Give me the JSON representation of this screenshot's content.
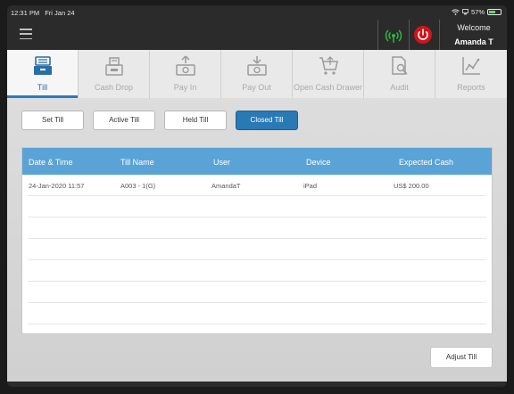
{
  "status_bar": {
    "time": "12:31 PM",
    "date": "Fri Jan 24",
    "battery": "57%",
    "battery_level": 0.57
  },
  "header": {
    "welcome": "Welcome",
    "user": "Amanda T"
  },
  "tabs": [
    {
      "label": "Till",
      "icon": "till-drawer-icon",
      "active": true
    },
    {
      "label": "Cash Drop",
      "icon": "cash-drop-icon"
    },
    {
      "label": "Pay In",
      "icon": "pay-in-icon"
    },
    {
      "label": "Pay Out",
      "icon": "pay-out-icon"
    },
    {
      "label": "Open Cash Drawer",
      "icon": "cart-icon"
    },
    {
      "label": "Audit",
      "icon": "audit-search-icon"
    },
    {
      "label": "Reports",
      "icon": "line-chart-icon"
    }
  ],
  "filters": [
    {
      "label": "Set Till"
    },
    {
      "label": "Active Till"
    },
    {
      "label": "Held Till"
    },
    {
      "label": "Closed Till",
      "selected": true
    }
  ],
  "table": {
    "columns": [
      "Date & Time",
      "Till Name",
      "User",
      "Device",
      "Expected Cash"
    ],
    "rows": [
      [
        "24-Jan-2020 11:57",
        "A003 - 1(G)",
        "AmandaT",
        "iPad",
        "US$ 200.00"
      ]
    ]
  },
  "actions": {
    "adjust_till": "Adjust Till"
  },
  "colors": {
    "accent": "#2979b5",
    "table_header": "#5aa3d6",
    "signal": "#2dbb3c",
    "power": "#d0141b"
  }
}
